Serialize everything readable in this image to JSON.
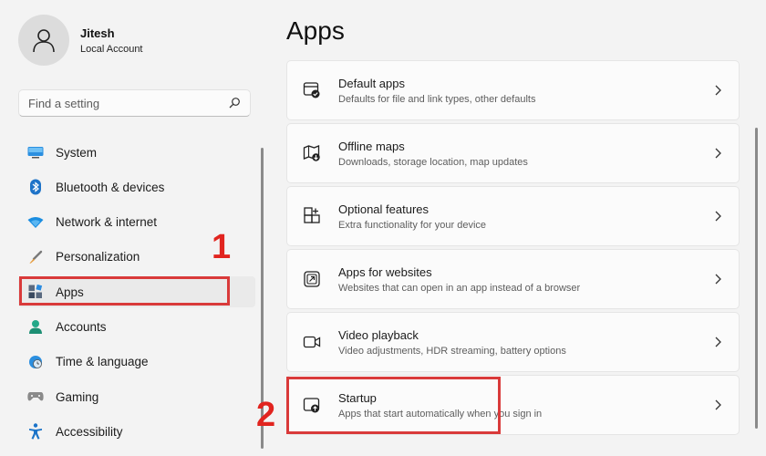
{
  "user": {
    "name": "Jitesh",
    "account_type": "Local Account"
  },
  "search": {
    "placeholder": "Find a setting"
  },
  "nav": {
    "items": [
      {
        "label": "System",
        "icon": "monitor-icon"
      },
      {
        "label": "Bluetooth & devices",
        "icon": "bluetooth-icon"
      },
      {
        "label": "Network & internet",
        "icon": "wifi-icon"
      },
      {
        "label": "Personalization",
        "icon": "brush-icon"
      },
      {
        "label": "Apps",
        "icon": "apps-icon",
        "selected": true
      },
      {
        "label": "Accounts",
        "icon": "person-icon"
      },
      {
        "label": "Time & language",
        "icon": "globe-clock-icon"
      },
      {
        "label": "Gaming",
        "icon": "gamepad-icon"
      },
      {
        "label": "Accessibility",
        "icon": "accessibility-icon"
      }
    ]
  },
  "main": {
    "title": "Apps",
    "cards": [
      {
        "title": "Default apps",
        "desc": "Defaults for file and link types, other defaults",
        "icon": "default-apps-icon"
      },
      {
        "title": "Offline maps",
        "desc": "Downloads, storage location, map updates",
        "icon": "map-icon"
      },
      {
        "title": "Optional features",
        "desc": "Extra functionality for your device",
        "icon": "optional-features-icon"
      },
      {
        "title": "Apps for websites",
        "desc": "Websites that can open in an app instead of a browser",
        "icon": "open-in-app-icon"
      },
      {
        "title": "Video playback",
        "desc": "Video adjustments, HDR streaming, battery options",
        "icon": "video-icon"
      },
      {
        "title": "Startup",
        "desc": "Apps that start automatically when you sign in",
        "icon": "startup-icon"
      }
    ]
  },
  "annotations": {
    "step1": "1",
    "step2": "2"
  },
  "colors": {
    "highlight": "#d93a3a",
    "callout": "#e1241f",
    "accent": "#0078d4"
  }
}
